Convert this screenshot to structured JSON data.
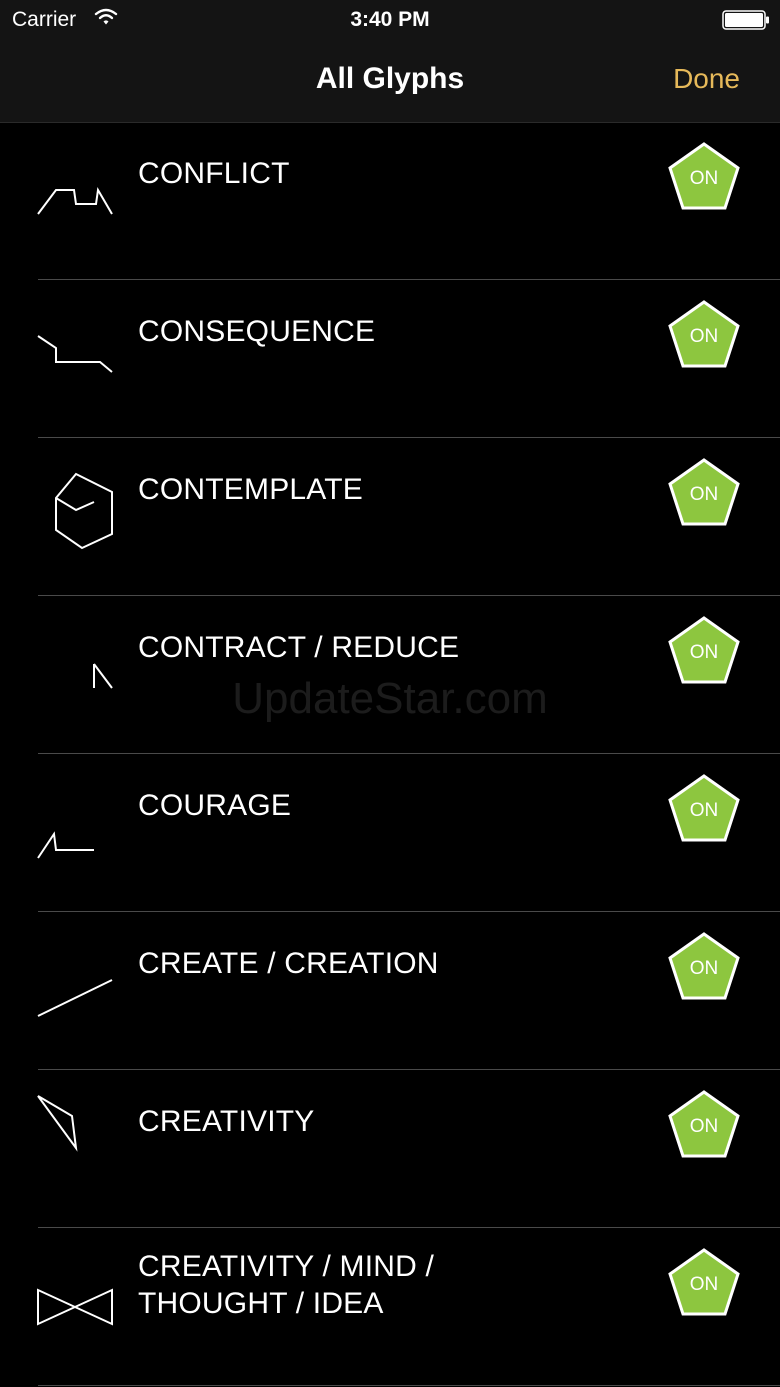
{
  "status": {
    "carrier": "Carrier",
    "time": "3:40 PM"
  },
  "nav": {
    "title": "All Glyphs",
    "done_label": "Done"
  },
  "colors": {
    "accent": "#e6b95a",
    "toggle_on": "#8dc63f",
    "background": "#000000"
  },
  "glyphs": [
    {
      "label": "CONFLICT",
      "toggle": "ON"
    },
    {
      "label": "CONSEQUENCE",
      "toggle": "ON"
    },
    {
      "label": "CONTEMPLATE",
      "toggle": "ON"
    },
    {
      "label": "CONTRACT / REDUCE",
      "toggle": "ON"
    },
    {
      "label": "COURAGE",
      "toggle": "ON"
    },
    {
      "label": "CREATE / CREATION",
      "toggle": "ON"
    },
    {
      "label": "CREATIVITY",
      "toggle": "ON"
    },
    {
      "label": "CREATIVITY / MIND / THOUGHT / IDEA",
      "toggle": "ON"
    }
  ],
  "watermark": "UpdateStar.com"
}
